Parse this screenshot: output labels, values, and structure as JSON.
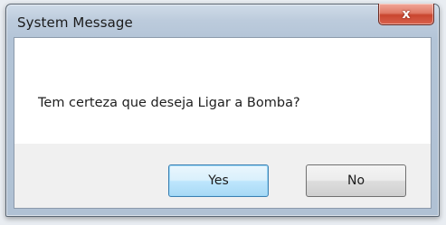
{
  "window": {
    "title": "System Message",
    "close_label": "x"
  },
  "dialog": {
    "message": "Tem certeza que deseja Ligar a Bomba?",
    "buttons": {
      "yes": "Yes",
      "no": "No"
    }
  },
  "colors": {
    "titlebar": "#b3c4d7",
    "close_button": "#c9452f",
    "default_button": "#bee6fd",
    "message_area": "#ffffff",
    "button_area": "#f0f0f0"
  }
}
